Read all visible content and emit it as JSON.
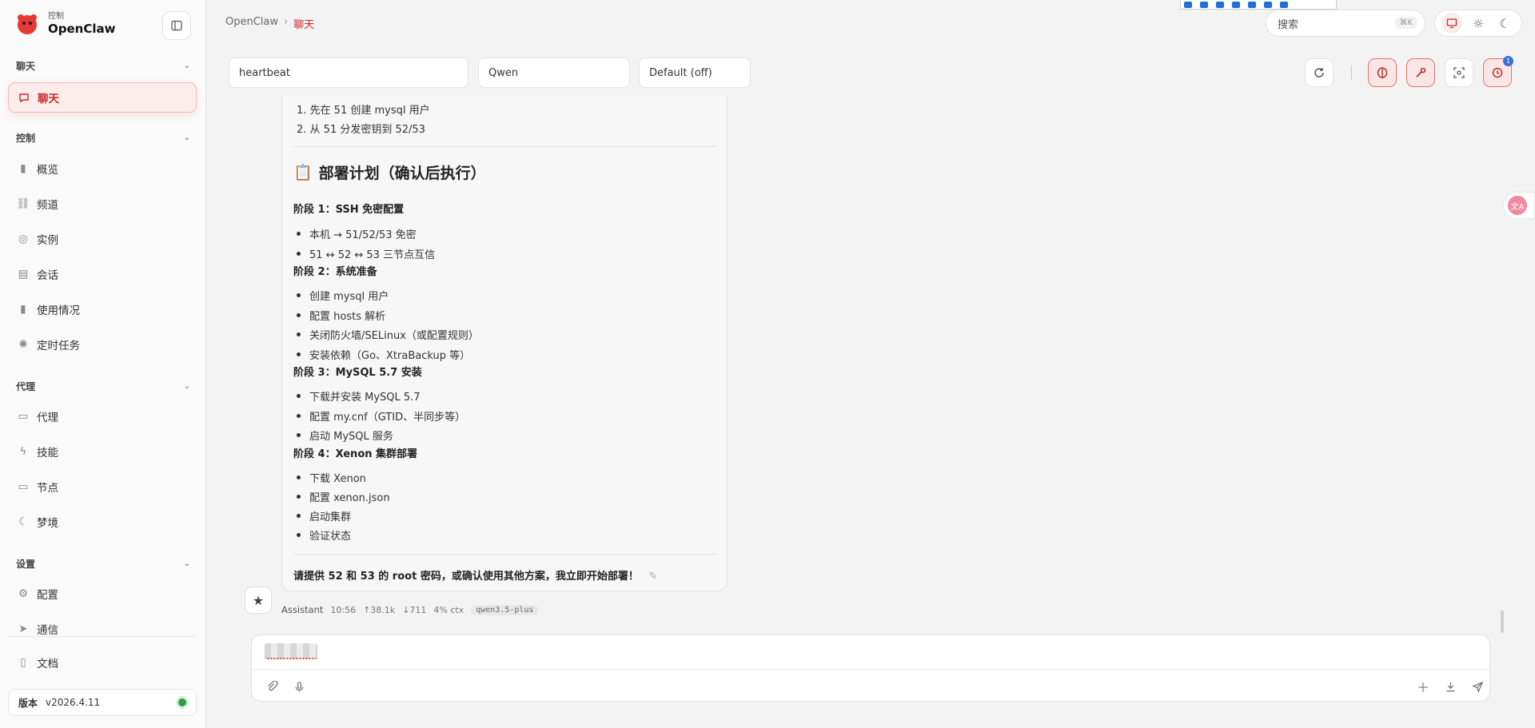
{
  "brand": {
    "sub": "控制",
    "name": "OpenClaw"
  },
  "sidebar": {
    "sections": [
      {
        "title": "聊天",
        "items": [
          {
            "label": "聊天",
            "icon": "chat-icon",
            "active": true
          }
        ]
      },
      {
        "title": "控制",
        "items": [
          {
            "label": "概览",
            "icon": "bar-chart-icon"
          },
          {
            "label": "频道",
            "icon": "link-icon"
          },
          {
            "label": "实例",
            "icon": "broadcast-icon"
          },
          {
            "label": "会话",
            "icon": "document-icon"
          },
          {
            "label": "使用情况",
            "icon": "bar-chart-icon"
          },
          {
            "label": "定时任务",
            "icon": "loader-icon"
          }
        ]
      },
      {
        "title": "代理",
        "items": [
          {
            "label": "代理",
            "icon": "folder-icon"
          },
          {
            "label": "技能",
            "icon": "bolt-icon"
          },
          {
            "label": "节点",
            "icon": "monitor-icon"
          },
          {
            "label": "梦境",
            "icon": "moon-icon"
          }
        ]
      },
      {
        "title": "设置",
        "items": [
          {
            "label": "配置",
            "icon": "gear-icon"
          },
          {
            "label": "通信",
            "icon": "send-icon"
          }
        ]
      }
    ],
    "docs": "文档",
    "version_label": "版本",
    "version_value": "v2026.4.11"
  },
  "breadcrumb": {
    "root": "OpenClaw",
    "sep": "›",
    "current": "聊天"
  },
  "search": {
    "placeholder": "搜索",
    "shortcut": "⌘K"
  },
  "toolbar": {
    "session": "heartbeat",
    "model": "Qwen",
    "thinking": "Default (off)",
    "badge": "1"
  },
  "message": {
    "intro_list": [
      "1. 先在 51 创建 mysql 用户",
      "2. 从 51 分发密钥到 52/53"
    ],
    "plan_title": "部署计划（确认后执行）",
    "stages": [
      {
        "title": "阶段 1：SSH 免密配置",
        "items": [
          "本机 → 51/52/53 免密",
          "51 ↔ 52 ↔ 53 三节点互信"
        ]
      },
      {
        "title": "阶段 2：系统准备",
        "items": [
          "创建 mysql 用户",
          "配置 hosts 解析",
          "关闭防火墙/SELinux（或配置规则）",
          "安装依赖（Go、XtraBackup 等）"
        ]
      },
      {
        "title": "阶段 3：MySQL 5.7 安装",
        "items": [
          "下载并安装 MySQL 5.7",
          "配置 my.cnf（GTID、半同步等）",
          "启动 MySQL 服务"
        ]
      },
      {
        "title": "阶段 4：Xenon 集群部署",
        "items": [
          "下载 Xenon",
          "配置 xenon.json",
          "启动集群",
          "验证状态"
        ]
      }
    ],
    "final": "请提供 52 和 53 的 root 密码，或确认使用其他方案，我立即开始部署！"
  },
  "meta": {
    "role": "Assistant",
    "time": "10:56",
    "tokens_in": "↑38.1k",
    "tokens_out": "↓711",
    "ctx": "4% ctx",
    "model": "qwen3.5-plus"
  },
  "composer": {
    "draft": "..."
  }
}
